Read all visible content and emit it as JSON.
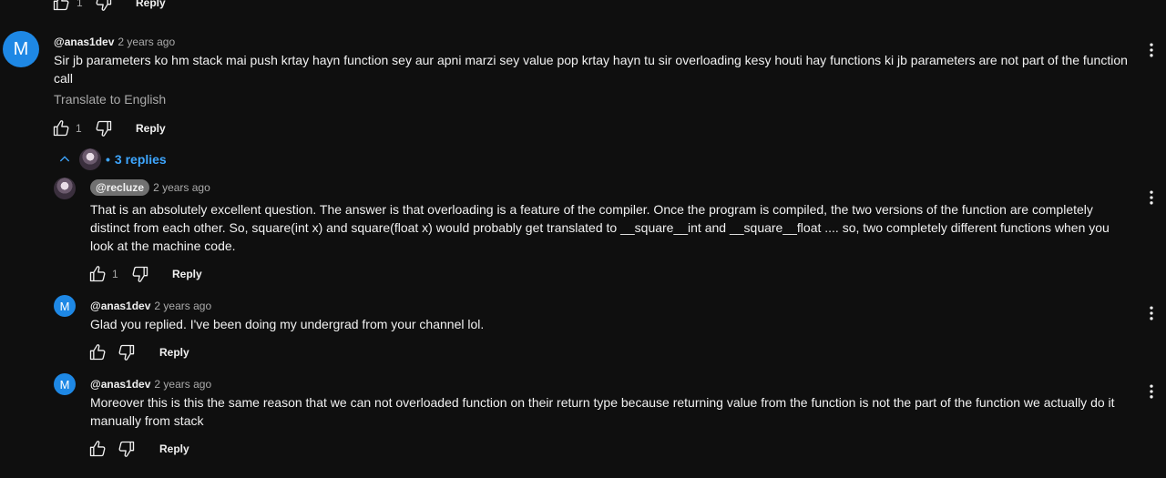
{
  "top_actions": {
    "like_count": "1",
    "reply_label": "Reply"
  },
  "comment": {
    "avatar_letter": "M",
    "author": "@anas1dev",
    "time": "2 years ago",
    "text": "Sir jb parameters ko hm stack mai push krtay hayn function sey aur apni marzi sey value pop krtay hayn tu sir overloading kesy houti hay functions ki jb parameters are not part of the function call",
    "translate_label": "Translate to English",
    "like_count": "1",
    "reply_label": "Reply",
    "replies_toggle": "3 replies",
    "bullet": "•"
  },
  "replies": [
    {
      "author": "@recluze",
      "time": "2 years ago",
      "text": "That is an absolutely excellent question. The answer is that overloading is a feature of the compiler. Once the program is compiled, the two versions of the function are completely distinct from each other. So, square(int x) and square(float x) would probably get translated to __square__int and __square__float .... so, two completely different functions when you look at the machine code.",
      "like_count": "1",
      "reply_label": "Reply"
    },
    {
      "avatar_letter": "M",
      "author": "@anas1dev",
      "time": "2 years ago",
      "text": "Glad you replied. I've been doing my undergrad from your channel lol.",
      "reply_label": "Reply"
    },
    {
      "avatar_letter": "M",
      "author": "@anas1dev",
      "time": "2 years ago",
      "text": "Moreover this is this the same reason that we can not overloaded function on their return type because returning value from the function is not the part of the function we actually do it manually from stack",
      "reply_label": "Reply"
    }
  ],
  "icons": {
    "like": "thumbs-up-icon",
    "dislike": "thumbs-down-icon",
    "more": "vertical-ellipsis-icon",
    "collapse": "chevron-up-icon"
  },
  "colors": {
    "background": "#0f0f0f",
    "text": "#f1f1f1",
    "secondary": "#aaaaaa",
    "link": "#3ea6ff",
    "avatar": "#1e88e5"
  }
}
